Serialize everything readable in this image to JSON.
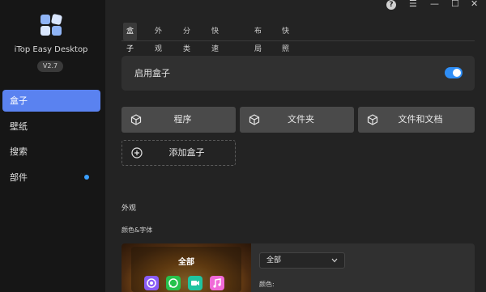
{
  "app": {
    "name": "iTop Easy Desktop",
    "version": "V2.7"
  },
  "sidebar": {
    "items": [
      {
        "label": "盒子",
        "active": true
      },
      {
        "label": "壁纸"
      },
      {
        "label": "搜索"
      },
      {
        "label": "部件",
        "badge": "dot"
      }
    ]
  },
  "window_controls": {
    "help": "?",
    "menu": "☰",
    "minimize": "—",
    "maximize": "☐",
    "close": "✕"
  },
  "tabs": [
    {
      "label": "盒子",
      "active": true
    },
    {
      "label": "外观"
    },
    {
      "label": "分类"
    },
    {
      "label": "快速操作"
    },
    {
      "label": "布局"
    },
    {
      "label": "快照"
    }
  ],
  "enable_box": {
    "label": "启用盒子",
    "enabled": true
  },
  "box_types": [
    {
      "label": "程序",
      "icon": "cube-icon"
    },
    {
      "label": "文件夹",
      "icon": "cube-icon"
    },
    {
      "label": "文件和文档",
      "icon": "cube-icon"
    }
  ],
  "add_box": {
    "label": "添加盒子",
    "icon": "plus-circle-icon"
  },
  "appearance": {
    "section_title": "外观",
    "subsection_title": "颜色&字体",
    "preview_title": "全部",
    "preview_apps": [
      "chrome-icon",
      "whatsapp-icon",
      "facetime-icon",
      "music-icon"
    ],
    "dropdown_value": "全部",
    "color_label": "颜色:"
  },
  "colors": {
    "accent": "#5a82f0",
    "toggle": "#2f8ef6",
    "badge": "#3aa0ff"
  }
}
